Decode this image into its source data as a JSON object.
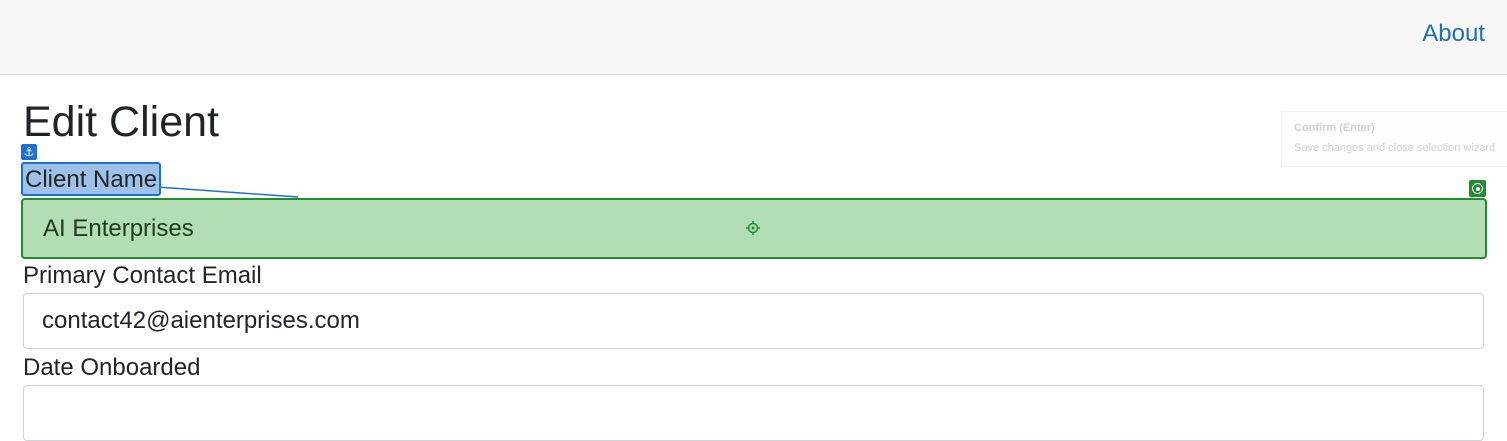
{
  "navbar": {
    "about_label": "About"
  },
  "page": {
    "title": "Edit Client"
  },
  "tooltip": {
    "title": "Confirm (Enter)",
    "description": "Save changes and close selection wizard"
  },
  "form": {
    "client_name": {
      "label": "Client Name",
      "value": "AI Enterprises"
    },
    "email": {
      "label": "Primary Contact Email",
      "value": "contact42@aienterprises.com"
    },
    "date_onboarded": {
      "label": "Date Onboarded",
      "value": ""
    }
  },
  "overlay": {
    "anchor_icon": "anchor-icon",
    "target_icon": "target-icon",
    "crosshair_icon": "crosshair-icon",
    "label_highlight_color": "#9ec1ea",
    "label_border_color": "#1d6fd1",
    "input_highlight_color": "#b3ddb5",
    "input_border_color": "#1e8e2e"
  },
  "colors": {
    "link": "#1f6fb2",
    "navbar_bg": "#f7f7f7"
  }
}
